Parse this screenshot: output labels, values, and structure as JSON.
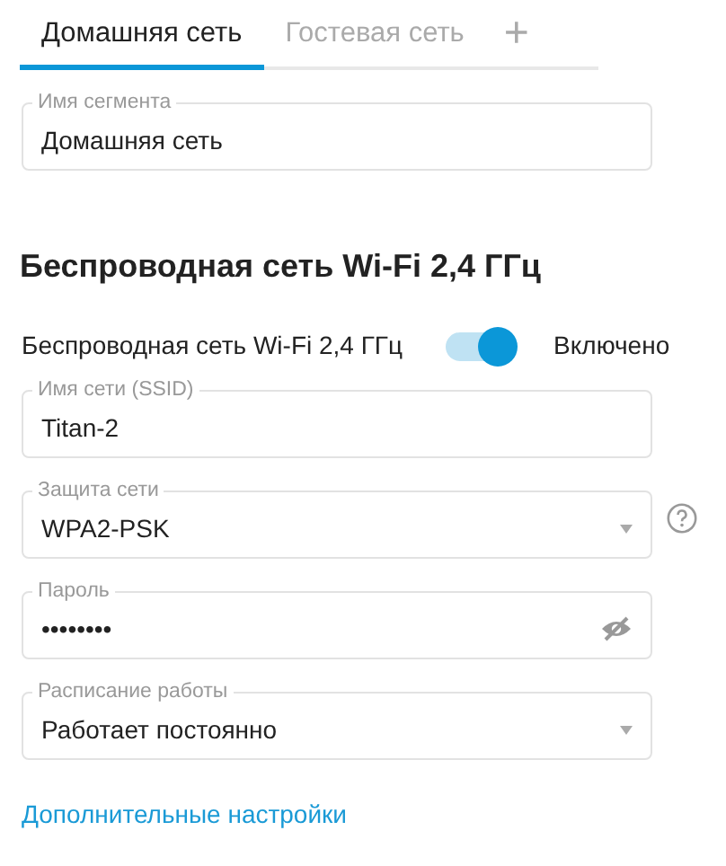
{
  "tabs": [
    {
      "label": "Домашняя сеть",
      "selected": true
    },
    {
      "label": "Гостевая сеть",
      "selected": false
    }
  ],
  "add_tab": "+",
  "segment_field": {
    "label": "Имя сегмента",
    "value": "Домашняя сеть"
  },
  "section_title": "Беспроводная сеть Wi-Fi 2,4 ГГц",
  "wifi_toggle": {
    "label": "Беспроводная сеть Wi-Fi 2,4 ГГц",
    "on": true,
    "state_text": "Включено"
  },
  "fields": [
    {
      "kind": "text",
      "label": "Имя сети (SSID)",
      "value": "Titan-2"
    },
    {
      "kind": "select",
      "label": "Защита сети",
      "value": "WPA2-PSK",
      "help": true
    },
    {
      "kind": "password",
      "label": "Пароль",
      "value": "••••••••"
    },
    {
      "kind": "select",
      "label": "Расписание работы",
      "value": "Работает постоянно"
    }
  ],
  "advanced_link": "Дополнительные настройки"
}
